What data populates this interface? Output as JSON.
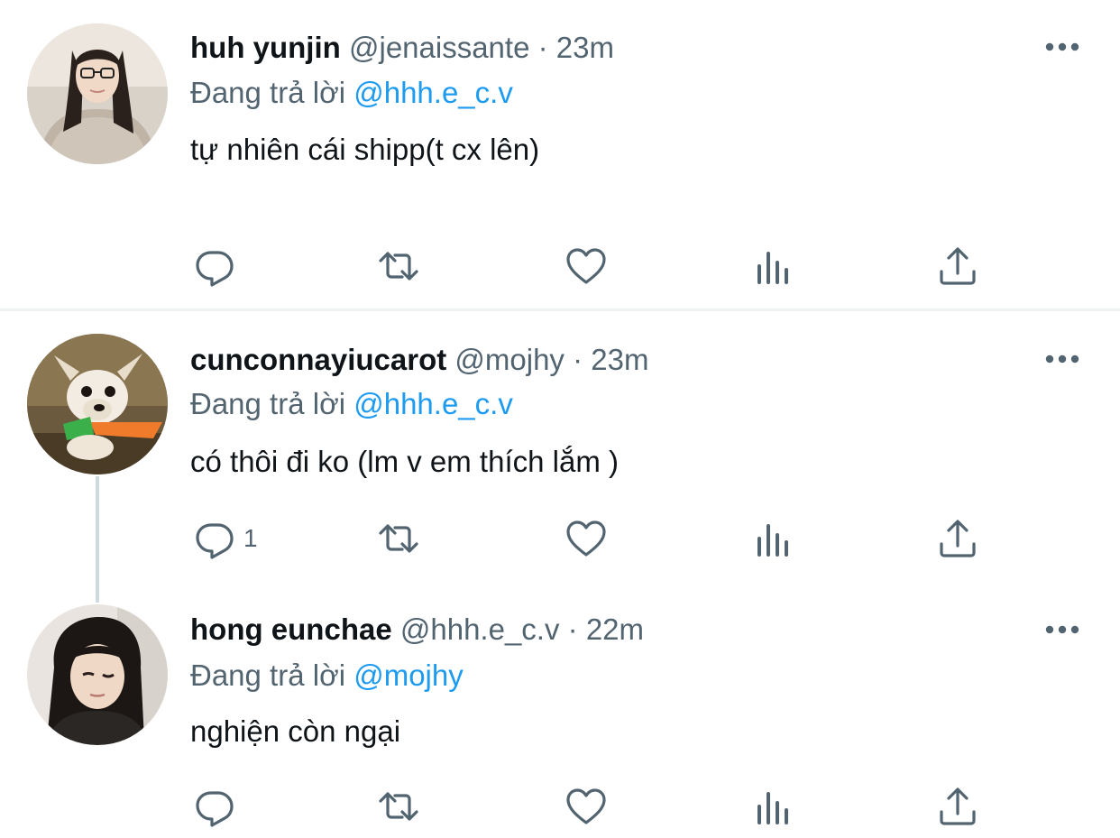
{
  "colors": {
    "text": "#0f1419",
    "secondary": "#536471",
    "link": "#1d9bf0",
    "divider": "#eff3f4",
    "thread_line": "#cfd9de"
  },
  "tweets": [
    {
      "name": "huh yunjin",
      "handle": "@jenaissante",
      "separator": "·",
      "time": "23m",
      "reply_prefix": "Đang trả lời",
      "reply_to": "@hhh.e_c.v",
      "text": "tự nhiên cái shipp(t cx lên)",
      "reply_count": "",
      "icons": [
        "reply-icon",
        "retweet-icon",
        "like-icon",
        "views-icon",
        "share-icon"
      ]
    },
    {
      "name": "cunconnayiucarot",
      "handle": "@mojhy",
      "separator": "·",
      "time": "23m",
      "reply_prefix": "Đang trả lời",
      "reply_to": "@hhh.e_c.v",
      "text": "có thôi đi ko (lm v em thích lắm )",
      "reply_count": "1",
      "icons": [
        "reply-icon",
        "retweet-icon",
        "like-icon",
        "views-icon",
        "share-icon"
      ]
    },
    {
      "name": "hong eunchae",
      "handle": "@hhh.e_c.v",
      "separator": "·",
      "time": "22m",
      "reply_prefix": "Đang trả lời",
      "reply_to": "@mojhy",
      "text": "nghiện còn ngại",
      "reply_count": "",
      "icons": [
        "reply-icon",
        "retweet-icon",
        "like-icon",
        "views-icon",
        "share-icon"
      ]
    }
  ]
}
